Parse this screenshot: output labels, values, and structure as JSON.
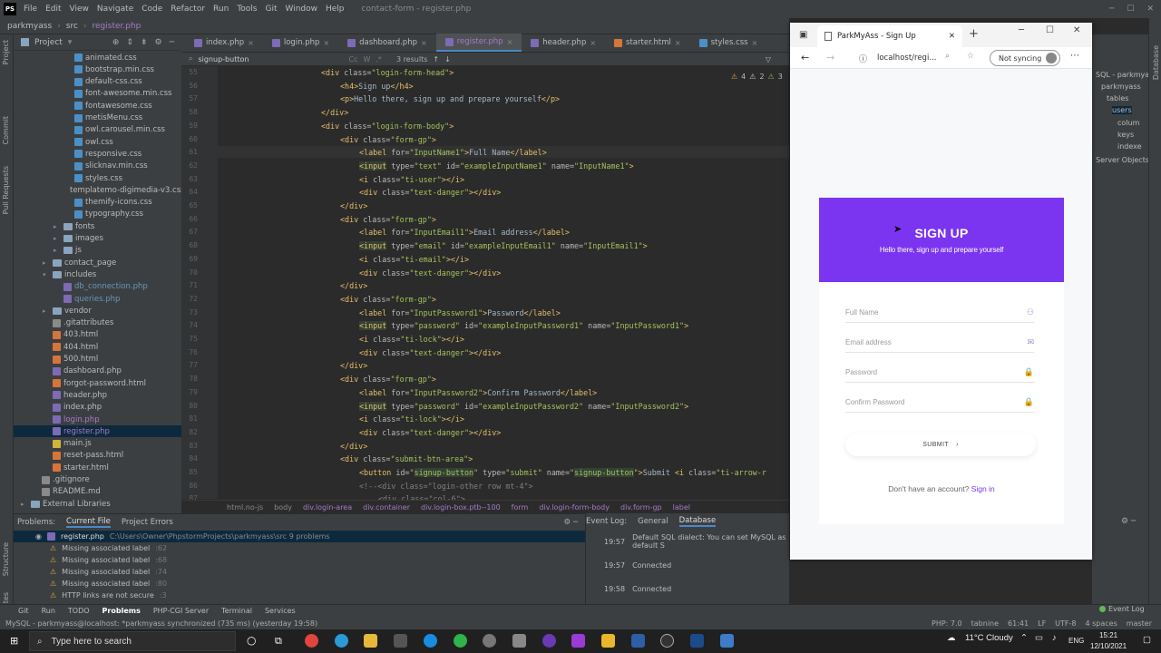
{
  "ide": {
    "title": "contact-form - register.php",
    "menu": [
      "File",
      "Edit",
      "View",
      "Navigate",
      "Code",
      "Refactor",
      "Run",
      "Tools",
      "Git",
      "Window",
      "Help"
    ],
    "breadcrumb": {
      "project": "parkmyass",
      "folder": "src",
      "file": "register.php"
    },
    "project_label": "Project",
    "tabs": [
      "index.php",
      "login.php",
      "dashboard.php",
      "register.php",
      "header.php",
      "starter.html",
      "styles.css"
    ],
    "active_tab": "register.php",
    "find": {
      "query": "signup-button",
      "results": "3 results"
    },
    "inspections": {
      "warnings": "4",
      "weak": "2",
      "typos": "3"
    },
    "tree": [
      {
        "name": "animated.css",
        "type": "css",
        "depth": 3
      },
      {
        "name": "bootstrap.min.css",
        "type": "css",
        "depth": 3
      },
      {
        "name": "default-css.css",
        "type": "css",
        "depth": 3
      },
      {
        "name": "font-awesome.min.css",
        "type": "css",
        "depth": 3
      },
      {
        "name": "fontawesome.css",
        "type": "css",
        "depth": 3
      },
      {
        "name": "metisMenu.css",
        "type": "css",
        "depth": 3
      },
      {
        "name": "owl.carousel.min.css",
        "type": "css",
        "depth": 3
      },
      {
        "name": "owl.css",
        "type": "css",
        "depth": 3
      },
      {
        "name": "responsive.css",
        "type": "css",
        "depth": 3
      },
      {
        "name": "slicknav.min.css",
        "type": "css",
        "depth": 3
      },
      {
        "name": "styles.css",
        "type": "css",
        "depth": 3
      },
      {
        "name": "templatemo-digimedia-v3.css",
        "type": "css",
        "depth": 3
      },
      {
        "name": "themify-icons.css",
        "type": "css",
        "depth": 3
      },
      {
        "name": "typography.css",
        "type": "css",
        "depth": 3
      },
      {
        "name": "fonts",
        "type": "dir",
        "depth": 2,
        "arrow": "▸"
      },
      {
        "name": "images",
        "type": "dir",
        "depth": 2,
        "arrow": "▸"
      },
      {
        "name": "js",
        "type": "dir",
        "depth": 2,
        "arrow": "▸"
      },
      {
        "name": "contact_page",
        "type": "dir",
        "depth": 1,
        "arrow": "▸"
      },
      {
        "name": "includes",
        "type": "dir",
        "depth": 1,
        "arrow": "▾"
      },
      {
        "name": "db_connection.php",
        "type": "php",
        "depth": 2,
        "blue": true
      },
      {
        "name": "queries.php",
        "type": "php",
        "depth": 2,
        "blue": true
      },
      {
        "name": "vendor",
        "type": "dir",
        "depth": 1,
        "arrow": "▸"
      },
      {
        "name": ".gitattributes",
        "type": "txt",
        "depth": 1
      },
      {
        "name": "403.html",
        "type": "html",
        "depth": 1
      },
      {
        "name": "404.html",
        "type": "html",
        "depth": 1
      },
      {
        "name": "500.html",
        "type": "html",
        "depth": 1
      },
      {
        "name": "dashboard.php",
        "type": "php",
        "depth": 1
      },
      {
        "name": "forgot-password.html",
        "type": "html",
        "depth": 1
      },
      {
        "name": "header.php",
        "type": "php",
        "depth": 1
      },
      {
        "name": "index.php",
        "type": "php",
        "depth": 1
      },
      {
        "name": "login.php",
        "type": "php",
        "depth": 1,
        "purple": true
      },
      {
        "name": "register.php",
        "type": "php",
        "depth": 1,
        "purple": true,
        "selected": true
      },
      {
        "name": "main.js",
        "type": "js",
        "depth": 1
      },
      {
        "name": "reset-pass.html",
        "type": "html",
        "depth": 1
      },
      {
        "name": "starter.html",
        "type": "html",
        "depth": 1
      },
      {
        "name": ".gitignore",
        "type": "txt",
        "depth": 0
      },
      {
        "name": "README.md",
        "type": "txt",
        "depth": 0
      },
      {
        "name": "External Libraries",
        "type": "dir",
        "depth": -1,
        "arrow": "▸"
      }
    ],
    "code_lines": [
      {
        "n": "55",
        "indent": 0,
        "html": "<span class=\"t\">&lt;div </span><span class=\"a\">class=</span><span class=\"v\">\"login-form-head\"</span><span class=\"t\">&gt;</span>"
      },
      {
        "n": "56",
        "indent": 1,
        "html": "<span class=\"t\">&lt;h4&gt;</span><span class=\"x\">Sign up</span><span class=\"t\">&lt;/h4&gt;</span>"
      },
      {
        "n": "57",
        "indent": 1,
        "html": "<span class=\"t\">&lt;p&gt;</span><span class=\"x\">Hello there, sign up and prepare yourself</span><span class=\"t\">&lt;/p&gt;</span>"
      },
      {
        "n": "58",
        "indent": 0,
        "html": "<span class=\"t\">&lt;/div&gt;</span>"
      },
      {
        "n": "59",
        "indent": 0,
        "html": "<span class=\"t\">&lt;div </span><span class=\"a\">class=</span><span class=\"v\">\"login-form-body\"</span><span class=\"t\">&gt;</span>"
      },
      {
        "n": "60",
        "indent": 1,
        "html": "<span class=\"t\">&lt;div </span><span class=\"a\">class=</span><span class=\"v\">\"form-gp\"</span><span class=\"t\">&gt;</span>"
      },
      {
        "n": "61",
        "indent": 2,
        "html": "<span class=\"t\">&lt;label </span><span class=\"a\">for=</span><span class=\"v\">\"InputName1\"</span><span class=\"t\">&gt;</span><span class=\"x\">Full Name</span><span class=\"t\">&lt;/label&gt;</span>"
      },
      {
        "n": "62",
        "indent": 2,
        "html": "<span class=\"t hl\">&lt;input</span><span class=\"a\"> type=</span><span class=\"v\">\"text\"</span><span class=\"a\"> id=</span><span class=\"v\">\"exampleInputName1\"</span><span class=\"a\"> name=</span><span class=\"v\">\"InputName1\"</span><span class=\"t\">&gt;</span>"
      },
      {
        "n": "63",
        "indent": 2,
        "html": "<span class=\"t\">&lt;i </span><span class=\"a\">class=</span><span class=\"v\">\"ti-user\"</span><span class=\"t\">&gt;&lt;/i&gt;</span>"
      },
      {
        "n": "64",
        "indent": 2,
        "html": "<span class=\"t\">&lt;div </span><span class=\"a\">class=</span><span class=\"v\">\"text-danger\"</span><span class=\"t\">&gt;&lt;/div&gt;</span>"
      },
      {
        "n": "65",
        "indent": 1,
        "html": "<span class=\"t\">&lt;/div&gt;</span>"
      },
      {
        "n": "66",
        "indent": 1,
        "html": "<span class=\"t\">&lt;div </span><span class=\"a\">class=</span><span class=\"v\">\"form-gp\"</span><span class=\"t\">&gt;</span>"
      },
      {
        "n": "67",
        "indent": 2,
        "html": "<span class=\"t\">&lt;label </span><span class=\"a\">for=</span><span class=\"v\">\"InputEmail1\"</span><span class=\"t\">&gt;</span><span class=\"x\">Email address</span><span class=\"t\">&lt;/label&gt;</span>"
      },
      {
        "n": "68",
        "indent": 2,
        "html": "<span class=\"t hl\">&lt;input</span><span class=\"a\"> type=</span><span class=\"v\">\"email\"</span><span class=\"a\"> id=</span><span class=\"v\">\"exampleInputEmail1\"</span><span class=\"a\"> name=</span><span class=\"v\">\"InputEmail1\"</span><span class=\"t\">&gt;</span>"
      },
      {
        "n": "69",
        "indent": 2,
        "html": "<span class=\"t\">&lt;i </span><span class=\"a\">class=</span><span class=\"v\">\"ti-email\"</span><span class=\"t\">&gt;&lt;/i&gt;</span>"
      },
      {
        "n": "70",
        "indent": 2,
        "html": "<span class=\"t\">&lt;div </span><span class=\"a\">class=</span><span class=\"v\">\"text-danger\"</span><span class=\"t\">&gt;&lt;/div&gt;</span>"
      },
      {
        "n": "71",
        "indent": 1,
        "html": "<span class=\"t\">&lt;/div&gt;</span>"
      },
      {
        "n": "72",
        "indent": 1,
        "html": "<span class=\"t\">&lt;div </span><span class=\"a\">class=</span><span class=\"v\">\"form-gp\"</span><span class=\"t\">&gt;</span>"
      },
      {
        "n": "73",
        "indent": 2,
        "html": "<span class=\"t\">&lt;label </span><span class=\"a\">for=</span><span class=\"v\">\"InputPassword1\"</span><span class=\"t\">&gt;</span><span class=\"x\">Password</span><span class=\"t\">&lt;/label&gt;</span>"
      },
      {
        "n": "74",
        "indent": 2,
        "html": "<span class=\"t hl\">&lt;input</span><span class=\"a\"> type=</span><span class=\"v\">\"password\"</span><span class=\"a\"> id=</span><span class=\"v\">\"exampleInputPassword1\"</span><span class=\"a\"> name=</span><span class=\"v\">\"InputPassword1\"</span><span class=\"t\">&gt;</span>"
      },
      {
        "n": "75",
        "indent": 2,
        "html": "<span class=\"t\">&lt;i </span><span class=\"a\">class=</span><span class=\"v\">\"ti-lock\"</span><span class=\"t\">&gt;&lt;/i&gt;</span>"
      },
      {
        "n": "76",
        "indent": 2,
        "html": "<span class=\"t\">&lt;div </span><span class=\"a\">class=</span><span class=\"v\">\"text-danger\"</span><span class=\"t\">&gt;&lt;/div&gt;</span>"
      },
      {
        "n": "77",
        "indent": 1,
        "html": "<span class=\"t\">&lt;/div&gt;</span>"
      },
      {
        "n": "78",
        "indent": 1,
        "html": "<span class=\"t\">&lt;div </span><span class=\"a\">class=</span><span class=\"v\">\"form-gp\"</span><span class=\"t\">&gt;</span>"
      },
      {
        "n": "79",
        "indent": 2,
        "html": "<span class=\"t\">&lt;label </span><span class=\"a\">for=</span><span class=\"v\">\"InputPassword2\"</span><span class=\"t\">&gt;</span><span class=\"x\">Confirm Password</span><span class=\"t\">&lt;/label&gt;</span>"
      },
      {
        "n": "80",
        "indent": 2,
        "html": "<span class=\"t hl\">&lt;input</span><span class=\"a\"> type=</span><span class=\"v\">\"password\"</span><span class=\"a\"> id=</span><span class=\"v\">\"exampleInputPassword2\"</span><span class=\"a\"> name=</span><span class=\"v\">\"InputPassword2\"</span><span class=\"t\">&gt;</span>"
      },
      {
        "n": "81",
        "indent": 2,
        "html": "<span class=\"t\">&lt;i </span><span class=\"a\">class=</span><span class=\"v\">\"ti-lock\"</span><span class=\"t\">&gt;&lt;/i&gt;</span>"
      },
      {
        "n": "82",
        "indent": 2,
        "html": "<span class=\"t\">&lt;div </span><span class=\"a\">class=</span><span class=\"v\">\"text-danger\"</span><span class=\"t\">&gt;&lt;/div&gt;</span>"
      },
      {
        "n": "83",
        "indent": 1,
        "html": "<span class=\"t\">&lt;/div&gt;</span>"
      },
      {
        "n": "84",
        "indent": 1,
        "html": "<span class=\"t\">&lt;div </span><span class=\"a\">class=</span><span class=\"v\">\"submit-btn-area\"</span><span class=\"t\">&gt;</span>"
      },
      {
        "n": "85",
        "indent": 2,
        "html": "<span class=\"t\">&lt;button </span><span class=\"a\">id=</span><span class=\"v\">\"<span class=\"hl\">signup-button</span>\"</span><span class=\"a\"> type=</span><span class=\"v\">\"submit\"</span><span class=\"a\"> name=</span><span class=\"v\">\"<span class=\"hl\">signup-button</span>\"</span><span class=\"t\">&gt;</span><span class=\"x\">Submit </span><span class=\"t\">&lt;i </span><span class=\"a\">class=</span><span class=\"v\">\"ti-arrow-r</span>"
      },
      {
        "n": "86",
        "indent": 2,
        "html": "<span class=\"cm\">&lt;!--&lt;div class=\"login-other row mt-4\"&gt;</span>"
      },
      {
        "n": "87",
        "indent": 3,
        "html": "<span class=\"cm\">&lt;div class=\"col-6\"&gt;</span>"
      }
    ],
    "path_crumbs": [
      "html.no-js",
      "body",
      "div.login-area",
      "div.container",
      "div.login-box.ptb--100",
      "form",
      "div.login-form-body",
      "div.form-gp",
      "label"
    ],
    "problems": {
      "tabs": [
        "Problems:",
        "Current File",
        "Project Errors"
      ],
      "file": "register.php",
      "path": "C:\\Users\\Owner\\PhpstormProjects\\parkmyass\\src  9 problems",
      "rows": [
        {
          "text": "Missing associated label",
          "line": ":62"
        },
        {
          "text": "Missing associated label",
          "line": ":68"
        },
        {
          "text": "Missing associated label",
          "line": ":74"
        },
        {
          "text": "Missing associated label",
          "line": ":80"
        },
        {
          "text": "HTTP links are not secure",
          "line": ":3"
        }
      ]
    },
    "event_log": {
      "tabs": [
        "Event Log:",
        "General",
        "Database"
      ],
      "rows": [
        {
          "time": "19:57",
          "text": "Default SQL dialect: You can set MySQL as default S"
        },
        {
          "time": "19:57",
          "text": "Connected"
        },
        {
          "time": "19:58",
          "text": "Connected"
        }
      ]
    },
    "tool_tabs": [
      "Git",
      "Run",
      "TODO",
      "Problems",
      "PHP-CGI Server",
      "Terminal",
      "Services"
    ],
    "event_log_label": "Event Log",
    "status": "MySQL - parkmyass@localhost: *parkmyass synchronized (735 ms) (yesterday 19:58)",
    "status_right": [
      "PHP: 7.0",
      "tabnine",
      "61:41",
      "LF",
      "UTF-8",
      "4 spaces",
      "master"
    ],
    "db_tree": [
      "SQL - parkmyass",
      "parkmyass",
      "tables",
      "users",
      "colum",
      "keys",
      "indexe",
      "Server Objects"
    ],
    "side_labels": {
      "left": [
        "Project",
        "Commit",
        "Pull Requests",
        "Structure",
        "Favorites"
      ],
      "right": [
        "Database"
      ]
    }
  },
  "browser": {
    "tab_title": "ParkMyAss - Sign Up",
    "url": "localhost/regi...",
    "sync_label": "Not syncing",
    "page": {
      "heading": "SIGN UP",
      "subheading": "Hello there, sign up and prepare yourself",
      "fields": [
        {
          "label": "Full Name",
          "icon": "user-icon",
          "glyph": "⚇"
        },
        {
          "label": "Email address",
          "icon": "email-icon",
          "glyph": "✉"
        },
        {
          "label": "Password",
          "icon": "lock-icon",
          "glyph": "🔒"
        },
        {
          "label": "Confirm Password",
          "icon": "lock-icon",
          "glyph": "🔒"
        }
      ],
      "submit": "SUBMIT",
      "signin_prompt": "Don't have an account?",
      "signin_link": "Sign in"
    },
    "accent": "#7b35f0"
  },
  "taskbar": {
    "search_placeholder": "Type here to search",
    "weather": "11°C  Cloudy",
    "lang": "ENG",
    "time": "15:21",
    "date": "12/10/2021"
  }
}
